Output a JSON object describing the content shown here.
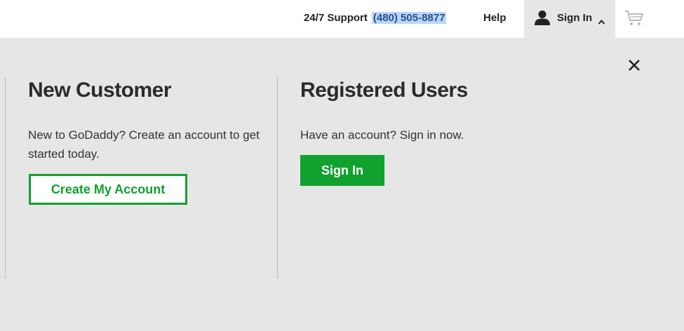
{
  "header": {
    "support_label": "24/7 Support",
    "support_phone": "(480) 505-8877",
    "help_label": "Help",
    "signin_label": "Sign In"
  },
  "new_customer": {
    "heading": "New Customer",
    "description": "New to GoDaddy? Create an account to get started today.",
    "button_label": "Create My Account"
  },
  "registered_users": {
    "heading": "Registered Users",
    "description": "Have an account? Sign in now.",
    "button_label": "Sign In"
  },
  "colors": {
    "accent_green": "#10a12f",
    "panel_bg": "#e6e6e6",
    "phone_highlight": "#b8d6fb"
  },
  "icons": [
    "user-icon",
    "chevron-up-icon",
    "cart-icon",
    "close-icon"
  ]
}
